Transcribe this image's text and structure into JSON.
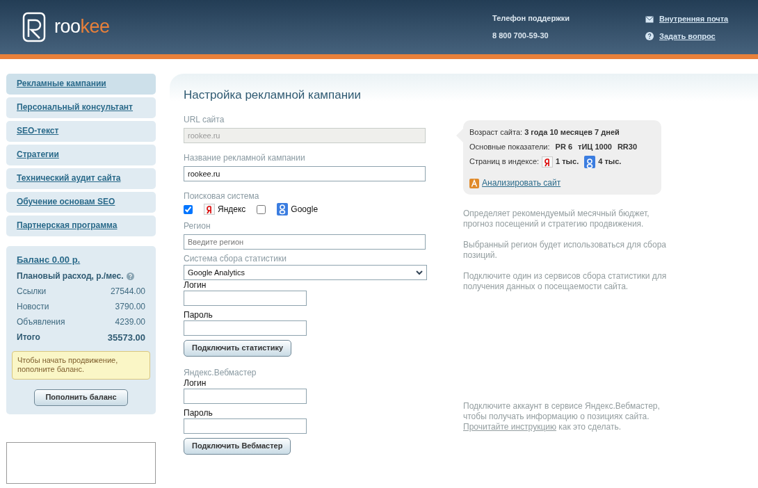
{
  "header": {
    "logo_parts": [
      "roo",
      "kee"
    ],
    "support_label": "Телефон поддержки",
    "support_phone": "8 800 700-59-30",
    "links": [
      {
        "kind": "mail",
        "label": "Внутренняя почта"
      },
      {
        "kind": "question",
        "label": "Задать вопрос"
      }
    ]
  },
  "sidebar": {
    "menu": [
      {
        "label": "Рекламные кампании",
        "selected": true
      },
      {
        "label": "Персональный консультант",
        "selected": false
      },
      {
        "label": "SEO-текст",
        "selected": false
      },
      {
        "label": "Стратегии",
        "selected": false
      },
      {
        "label": "Технический аудит сайта",
        "selected": false
      },
      {
        "label": "Обучение основам SEO",
        "selected": false
      },
      {
        "label": "Партнерская программа",
        "selected": false
      }
    ],
    "balance": {
      "title": "Баланс 0.00 р.",
      "plan_label": "Плановый расход, р./мес.",
      "rows": [
        {
          "label": "Ссылки",
          "value": "27544.00"
        },
        {
          "label": "Новости",
          "value": "3790.00"
        },
        {
          "label": "Объявления",
          "value": "4239.00"
        }
      ],
      "total": {
        "label": "Итого",
        "value": "35573.00"
      },
      "notice": "Чтобы начать продвижение, пополните баланс.",
      "button": "Пополнить баланс"
    }
  },
  "main": {
    "title": "Настройка рекламной кампании",
    "url": {
      "label": "URL сайта",
      "value": "rookee.ru",
      "disabled": true
    },
    "campaign": {
      "label": "Название рекламной кампании",
      "value": "rookee.ru"
    },
    "engines": {
      "label": "Поисковая система",
      "items": [
        {
          "kind": "yandex",
          "label": "Яндекс",
          "checked": true
        },
        {
          "kind": "google",
          "label": "Google",
          "checked": false
        }
      ]
    },
    "region": {
      "label": "Регион",
      "placeholder": "Введите регион"
    },
    "stats": {
      "label": "Система сбора статистики",
      "value": "Google Analytics",
      "login_label": "Логин",
      "password_label": "Пароль",
      "button": "Подключить статистику"
    },
    "webmaster": {
      "label": "Яндекс.Вебмастер",
      "login_label": "Логин",
      "password_label": "Пароль",
      "button": "Подключить Вебмастер"
    },
    "site_info": {
      "age_label": "Возраст сайта:",
      "age": "3 года 10 месяцев 7 дней",
      "metrics_label": "Основные показатели:",
      "metrics": [
        "PR 6",
        "тИЦ 1000",
        "RR30"
      ],
      "index_label": "Страниц в индексе:",
      "index": [
        {
          "kind": "yandex",
          "value": "1 тыс."
        },
        {
          "kind": "google",
          "value": "4 тыс."
        }
      ],
      "analyze_link": "Анализировать сайт"
    },
    "hints": {
      "campaign": "Определяет рекомендуемый месячный бюджет, прогноз посещений и стратегию продвижения.",
      "region": "Выбранный регион будет использоваться для сбора позиций.",
      "stats": "Подключите один из сервисов сбора статистики для получения данных о посещаемости сайта.",
      "webmaster": "Подключите аккаунт в сервисе Яндекс.Вебмастер, чтобы получать информацию о позициях сайта.",
      "webmaster_link": "Прочитайте инструкцию",
      "webmaster_tail": "как это сделать."
    }
  }
}
